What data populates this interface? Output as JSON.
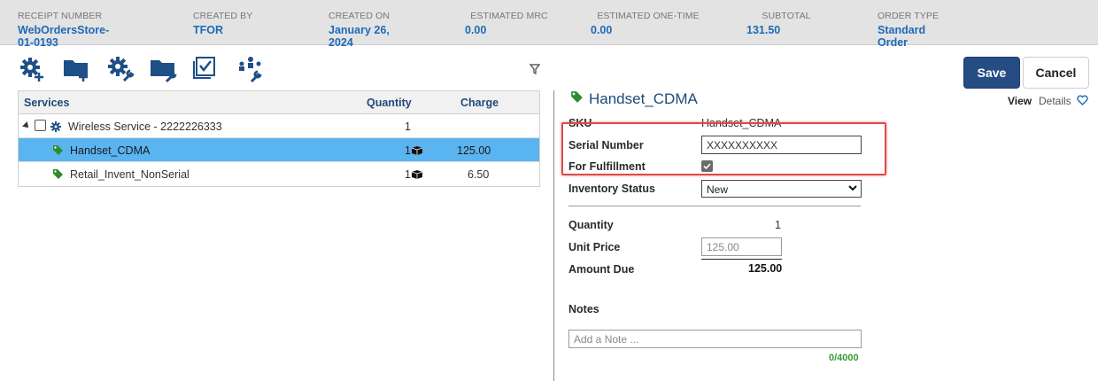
{
  "header": {
    "receipt_number": {
      "label": "RECEIPT NUMBER",
      "value": "WebOrdersStore-01-0193"
    },
    "created_by": {
      "label": "CREATED BY",
      "value": "TFOR"
    },
    "created_on": {
      "label": "CREATED ON",
      "value": "January 26, 2024"
    },
    "estimated_mrc": {
      "label": "ESTIMATED MRC",
      "value": "0.00"
    },
    "estimated_one_time": {
      "label": "ESTIMATED ONE-TIME",
      "value": "0.00"
    },
    "subtotal": {
      "label": "SUBTOTAL",
      "value": "131.50"
    },
    "order_type": {
      "label": "ORDER TYPE",
      "value": "Standard Order"
    }
  },
  "toolbar": {
    "icons": [
      "add-service-icon",
      "add-folder-icon",
      "configure-service-icon",
      "configure-folder-icon",
      "bulk-check-icon",
      "group-configure-icon",
      "filter-icon"
    ],
    "save_label": "Save",
    "cancel_label": "Cancel"
  },
  "services_table": {
    "columns": {
      "services": "Services",
      "quantity": "Quantity",
      "charge": "Charge"
    },
    "rows": [
      {
        "name": "Wireless Service - 2222226333",
        "quantity": "1",
        "charge": ""
      },
      {
        "name": "Handset_CDMA",
        "quantity": "1",
        "charge": "125.00",
        "selected": true
      },
      {
        "name": "Retail_Invent_NonSerial",
        "quantity": "1",
        "charge": "6.50"
      }
    ]
  },
  "detail": {
    "title": "Handset_CDMA",
    "view_tabs": {
      "view": "View",
      "details": "Details"
    },
    "sku": {
      "label": "SKU",
      "value": "Handset_CDMA"
    },
    "serial_number": {
      "label": "Serial Number",
      "value": "XXXXXXXXXX"
    },
    "for_fulfillment": {
      "label": "For Fulfillment",
      "checked": true
    },
    "inventory_status": {
      "label": "Inventory Status",
      "value": "New"
    },
    "quantity": {
      "label": "Quantity",
      "value": "1"
    },
    "unit_price": {
      "label": "Unit Price",
      "value": "125.00"
    },
    "amount_due": {
      "label": "Amount Due",
      "value": "125.00"
    },
    "notes": {
      "label": "Notes",
      "placeholder": "Add a Note ...",
      "counter": "0/4000"
    }
  },
  "colors": {
    "accent": "#1e6ab8",
    "save_button": "#254d84",
    "selected_row": "#5ab4f0",
    "highlight_box": "#e04848",
    "tag_green": "#2e8b2e"
  }
}
